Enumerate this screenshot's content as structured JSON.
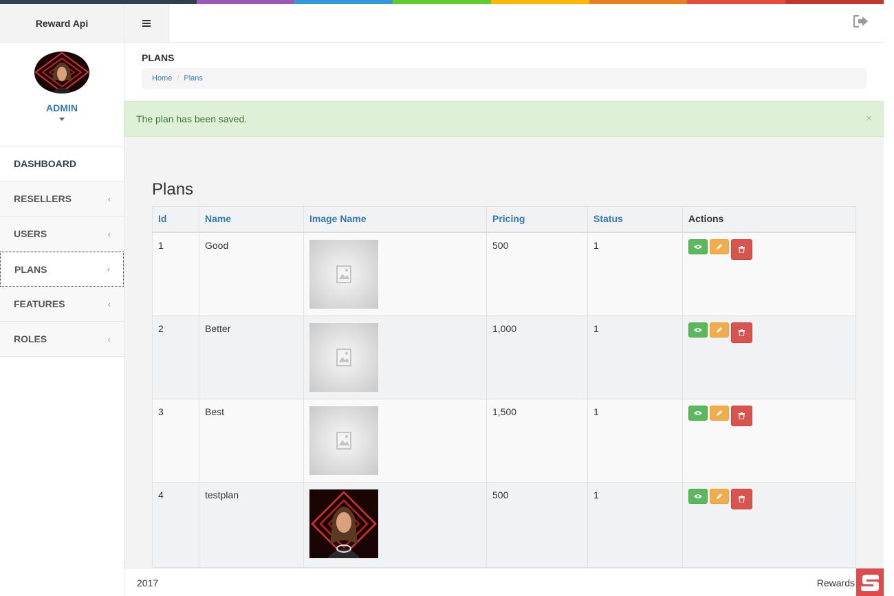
{
  "app": {
    "title": "Reward Api"
  },
  "colors": {
    "top_stripe": [
      "#2f4050",
      "#2f4050",
      "#9b59b6",
      "#3498db",
      "#62cb31",
      "#ffb606",
      "#e67e22",
      "#e74c3c",
      "#c0392b"
    ],
    "accent": "#337ab7",
    "success_alert_bg": "#dff0d8",
    "view_button": "#5cb85c",
    "edit_button": "#f0ad4e",
    "delete_button": "#d9534f"
  },
  "profile": {
    "name": "ADMIN",
    "menu_icon": "caret-down-icon"
  },
  "topbar": {
    "menu_icon": "hamburger-menu-icon",
    "logout_icon": "sign-out-icon"
  },
  "sidebar": {
    "items": [
      {
        "label": "DASHBOARD",
        "has_chevron": false
      },
      {
        "label": "RESELLERS",
        "has_chevron": true
      },
      {
        "label": "USERS",
        "has_chevron": true
      },
      {
        "label": "PLANS",
        "has_chevron": true,
        "active": true
      },
      {
        "label": "FEATURES",
        "has_chevron": true
      },
      {
        "label": "ROLES",
        "has_chevron": true
      }
    ],
    "chevron": "‹"
  },
  "page": {
    "heading": "PLANS",
    "breadcrumb": {
      "home": "Home",
      "separator": "/",
      "current": "Plans"
    }
  },
  "alert": {
    "message": "The plan has been saved.",
    "close": "×"
  },
  "main": {
    "title": "Plans",
    "table": {
      "headers": {
        "id": "Id",
        "name": "Name",
        "image": "Image Name",
        "pricing": "Pricing",
        "status": "Status",
        "actions": "Actions"
      },
      "rows": [
        {
          "id": "1",
          "name": "Good",
          "image": "placeholder",
          "pricing": "500",
          "status": "1"
        },
        {
          "id": "2",
          "name": "Better",
          "image": "placeholder",
          "pricing": "1,000",
          "status": "1"
        },
        {
          "id": "3",
          "name": "Best",
          "image": "placeholder",
          "pricing": "1,500",
          "status": "1"
        },
        {
          "id": "4",
          "name": "testplan",
          "image": "photo",
          "pricing": "500",
          "status": "1"
        }
      ],
      "action_icons": {
        "view": "eye-icon",
        "edit": "pencil-icon",
        "delete": "trash-icon"
      }
    }
  },
  "footer": {
    "year": "2017",
    "company": "Rewards"
  }
}
